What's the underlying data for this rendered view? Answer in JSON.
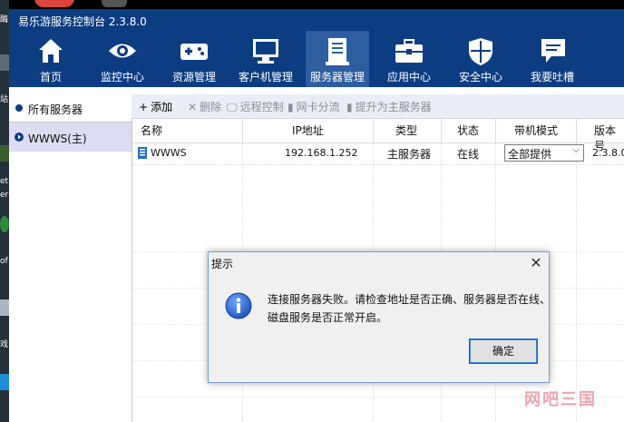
{
  "window": {
    "title": "易乐游服务控制台 2.3.8.0"
  },
  "nav": [
    {
      "label": "首页",
      "icon": "home-icon"
    },
    {
      "label": "监控中心",
      "icon": "eye-icon"
    },
    {
      "label": "资源管理",
      "icon": "gamepad-icon"
    },
    {
      "label": "客户机管理",
      "icon": "monitor-icon"
    },
    {
      "label": "服务器管理",
      "icon": "server-document-icon",
      "active": true
    },
    {
      "label": "应用中心",
      "icon": "toolbox-icon"
    },
    {
      "label": "安全中心",
      "icon": "shield-icon"
    },
    {
      "label": "我要吐槽",
      "icon": "chat-icon"
    }
  ],
  "sidebar": {
    "items": [
      {
        "label": "所有服务器"
      },
      {
        "label": "WWWS(主)",
        "selected": true
      }
    ]
  },
  "toolbar": {
    "add": "添加",
    "delete": "删除",
    "remote": "远程控制",
    "nic_split": "网卡分流",
    "promote": "提升为主服务器"
  },
  "table": {
    "headers": [
      "名称",
      "IP地址",
      "类型",
      "状态",
      "带机模式",
      "版本号"
    ],
    "rows": [
      {
        "name": "WWWS",
        "ip": "192.168.1.252",
        "type": "主服务器",
        "status": "在线",
        "mode": "全部提供",
        "version": "2.3.8.0"
      }
    ]
  },
  "dialog": {
    "title": "提示",
    "message_line1": "连接服务器失败。请检查地址是否正确、服务器是否在线、",
    "message_line2": "磁盘服务是否正常开启。",
    "ok": "确定"
  },
  "desktop_fragments": [
    "酶",
    "站",
    "et",
    "er",
    "of",
    "戏"
  ],
  "watermark": "网吧三国",
  "colors": {
    "header_blue": "#0c3d82",
    "active_nav": "#2d5ea0",
    "selected_row": "#dcdcf3",
    "watermark": "#e78f9a"
  }
}
